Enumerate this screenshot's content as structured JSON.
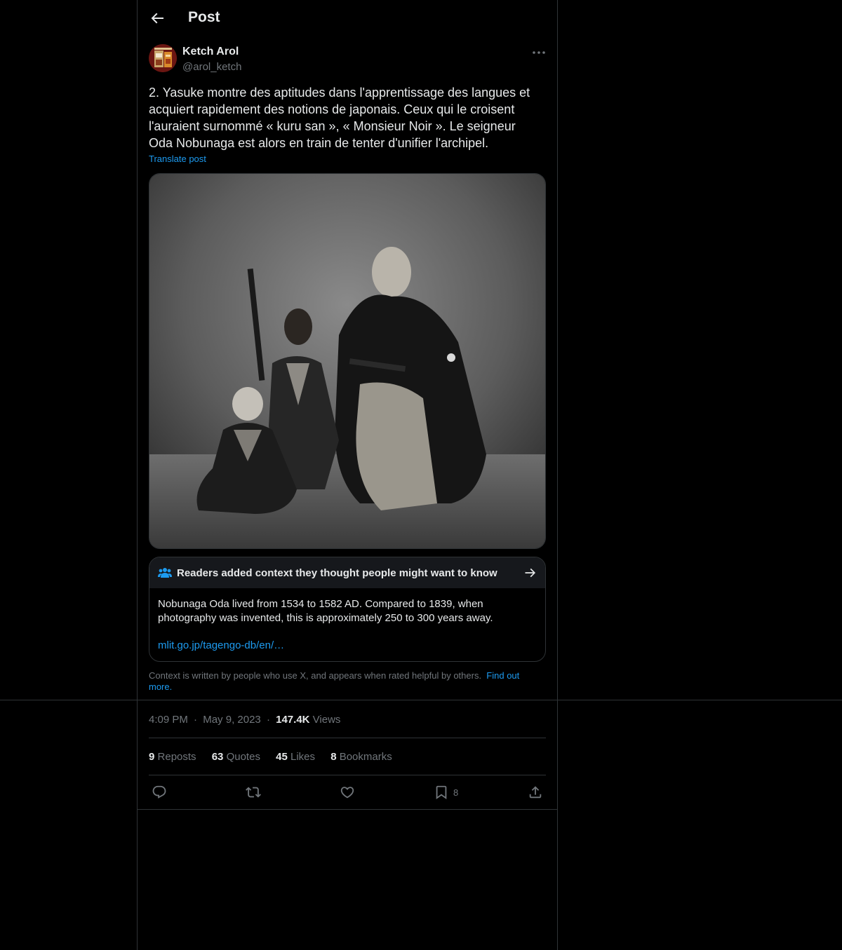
{
  "header": {
    "title": "Post"
  },
  "author": {
    "name": "Ketch Arol",
    "handle": "@arol_ketch"
  },
  "post": {
    "text": "2. Yasuke montre des aptitudes dans l'apprentissage des langues et acquiert rapidement des notions de japonais. Ceux qui le croisent l'auraient surnommé « kuru san », « Monsieur Noir ». Le seigneur Oda Nobunaga est alors en train de tenter d'unifier l'archipel.",
    "translate_label": "Translate post"
  },
  "community_note": {
    "title": "Readers added context they thought people might want to know",
    "body": "Nobunaga Oda lived from 1534 to 1582 AD. Compared to 1839, when photography was invented, this is approximately 250 to 300 years away.",
    "link": "mlit.go.jp/tagengo-db/en/…",
    "disclaimer": "Context is written by people who use X, and appears when rated helpful by others.",
    "find_out_more": "Find out more."
  },
  "meta": {
    "time": "4:09 PM",
    "dot": "·",
    "date": "May 9, 2023",
    "views_count": "147.4K",
    "views_label": "Views"
  },
  "stats": {
    "reposts_count": "9",
    "reposts_label": "Reposts",
    "quotes_count": "63",
    "quotes_label": "Quotes",
    "likes_count": "45",
    "likes_label": "Likes",
    "bookmarks_count": "8",
    "bookmarks_label": "Bookmarks"
  },
  "actions": {
    "bookmark_count": "8"
  },
  "colors": {
    "accent": "#1d9bf0",
    "muted": "#71767b",
    "border": "#2f3336",
    "text": "#e7e9ea",
    "background": "#000000"
  },
  "icons": [
    "back-arrow-icon",
    "more-icon",
    "community-notes-icon",
    "arrow-right-icon",
    "reply-icon",
    "repost-icon",
    "like-icon",
    "bookmark-icon",
    "share-icon"
  ]
}
